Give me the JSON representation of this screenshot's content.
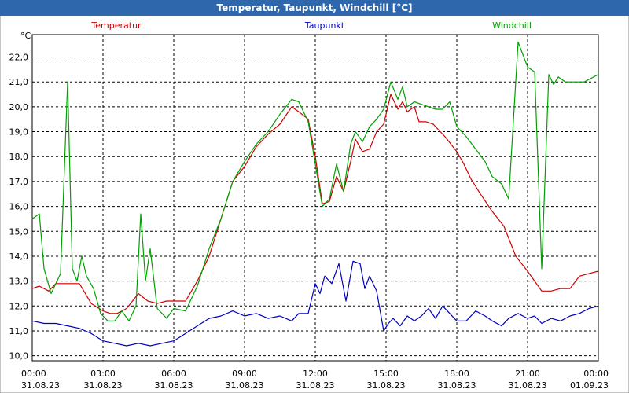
{
  "window": {
    "title": "Temperatur, Taupunkt, Windchill [°C]"
  },
  "colors": {
    "title_bar": "#2f67ad",
    "title_text": "#ffffff",
    "background": "#ffffff",
    "grid": "#000000"
  },
  "chart_data": {
    "type": "line",
    "title": "Temperatur, Taupunkt, Windchill [°C]",
    "ylabel": "°C",
    "xlabel": "",
    "ylim": [
      9.8,
      22.9
    ],
    "xlim": [
      0,
      24
    ],
    "grid": true,
    "legend_placement": "top",
    "y_ticks": [
      "10,0",
      "11,0",
      "12,0",
      "13,0",
      "14,0",
      "15,0",
      "16,0",
      "17,0",
      "18,0",
      "19,0",
      "20,0",
      "21,0",
      "22,0"
    ],
    "x_ticks": [
      {
        "time": "00:00",
        "date": "31.08.23"
      },
      {
        "time": "03:00",
        "date": "31.08.23"
      },
      {
        "time": "06:00",
        "date": "31.08.23"
      },
      {
        "time": "09:00",
        "date": "31.08.23"
      },
      {
        "time": "12:00",
        "date": "31.08.23"
      },
      {
        "time": "15:00",
        "date": "31.08.23"
      },
      {
        "time": "18:00",
        "date": "31.08.23"
      },
      {
        "time": "21:00",
        "date": "31.08.23"
      },
      {
        "time": "00:00",
        "date": "01.09.23"
      }
    ],
    "series": [
      {
        "name": "Temperatur",
        "color": "#d00000",
        "x": [
          0,
          0.3,
          0.7,
          1.0,
          1.5,
          2.0,
          2.5,
          3.0,
          3.3,
          3.6,
          4.0,
          4.5,
          4.9,
          5.3,
          5.7,
          6.0,
          6.5,
          7.0,
          7.5,
          8.0,
          8.5,
          9.0,
          9.5,
          10.0,
          10.5,
          11.0,
          11.3,
          11.7,
          12.0,
          12.3,
          12.6,
          12.9,
          13.2,
          13.5,
          13.7,
          14.0,
          14.3,
          14.6,
          14.9,
          15.2,
          15.5,
          15.7,
          15.9,
          16.2,
          16.4,
          16.7,
          17.0,
          17.5,
          18.0,
          18.3,
          18.6,
          19.0,
          19.5,
          20.0,
          20.5,
          21.0,
          21.3,
          21.6,
          22.0,
          22.4,
          22.8,
          23.2,
          23.6,
          24.0
        ],
        "values": [
          12.7,
          12.8,
          12.6,
          12.9,
          12.9,
          12.9,
          12.1,
          11.8,
          11.7,
          11.7,
          11.9,
          12.5,
          12.2,
          12.1,
          12.2,
          12.2,
          12.2,
          13.0,
          14.0,
          15.5,
          17.0,
          17.6,
          18.4,
          18.9,
          19.3,
          20.0,
          19.8,
          19.5,
          18.0,
          16.1,
          16.2,
          17.2,
          16.6,
          17.8,
          18.7,
          18.2,
          18.3,
          19.0,
          19.3,
          20.5,
          19.9,
          20.2,
          19.8,
          20.0,
          19.4,
          19.4,
          19.3,
          18.8,
          18.2,
          17.7,
          17.1,
          16.5,
          15.8,
          15.2,
          14.0,
          13.4,
          13.0,
          12.6,
          12.6,
          12.7,
          12.7,
          13.2,
          13.3,
          13.4
        ]
      },
      {
        "name": "Taupunkt",
        "color": "#0000c0",
        "x": [
          0,
          0.5,
          1.0,
          1.5,
          2.0,
          2.5,
          3.0,
          3.5,
          4.0,
          4.5,
          5.0,
          5.5,
          6.0,
          6.5,
          7.0,
          7.5,
          8.0,
          8.5,
          9.0,
          9.5,
          10.0,
          10.5,
          11.0,
          11.3,
          11.7,
          12.0,
          12.2,
          12.4,
          12.7,
          13.0,
          13.3,
          13.6,
          13.9,
          14.1,
          14.3,
          14.6,
          14.9,
          15.1,
          15.3,
          15.6,
          15.9,
          16.2,
          16.5,
          16.8,
          17.1,
          17.4,
          17.7,
          18.0,
          18.4,
          18.8,
          19.2,
          19.5,
          19.9,
          20.2,
          20.6,
          21.0,
          21.3,
          21.6,
          22.0,
          22.4,
          22.8,
          23.2,
          23.6,
          24.0
        ],
        "values": [
          11.4,
          11.3,
          11.3,
          11.2,
          11.1,
          10.9,
          10.6,
          10.5,
          10.4,
          10.5,
          10.4,
          10.5,
          10.6,
          10.9,
          11.2,
          11.5,
          11.6,
          11.8,
          11.6,
          11.7,
          11.5,
          11.6,
          11.4,
          11.7,
          11.7,
          12.9,
          12.5,
          13.2,
          12.9,
          13.7,
          12.2,
          13.8,
          13.7,
          12.7,
          13.2,
          12.6,
          11.0,
          11.3,
          11.5,
          11.2,
          11.6,
          11.4,
          11.6,
          11.9,
          11.5,
          12.0,
          11.7,
          11.4,
          11.4,
          11.8,
          11.6,
          11.4,
          11.2,
          11.5,
          11.7,
          11.5,
          11.6,
          11.3,
          11.5,
          11.4,
          11.6,
          11.7,
          11.9,
          12.0
        ]
      },
      {
        "name": "Windchill",
        "color": "#00a000",
        "x": [
          0,
          0.3,
          0.5,
          0.8,
          1.0,
          1.2,
          1.5,
          1.7,
          1.9,
          2.1,
          2.3,
          2.6,
          2.9,
          3.2,
          3.5,
          3.8,
          4.1,
          4.4,
          4.6,
          4.8,
          5.0,
          5.3,
          5.7,
          6.0,
          6.5,
          7.0,
          7.5,
          8.0,
          8.5,
          9.0,
          9.5,
          10.0,
          10.5,
          11.0,
          11.3,
          11.7,
          12.0,
          12.3,
          12.6,
          12.9,
          13.2,
          13.5,
          13.7,
          14.0,
          14.3,
          14.6,
          14.9,
          15.2,
          15.5,
          15.7,
          15.9,
          16.2,
          16.5,
          16.8,
          17.1,
          17.4,
          17.7,
          18.0,
          18.4,
          18.8,
          19.2,
          19.5,
          19.9,
          20.2,
          20.6,
          21.0,
          21.3,
          21.6,
          21.9,
          22.1,
          22.3,
          22.6,
          23.0,
          23.4,
          23.8,
          24.0
        ],
        "values": [
          15.5,
          15.7,
          13.5,
          12.5,
          12.9,
          13.3,
          21.0,
          13.5,
          13.0,
          14.0,
          13.2,
          12.7,
          11.7,
          11.4,
          11.4,
          11.8,
          11.4,
          12.0,
          15.7,
          13.0,
          14.3,
          11.9,
          11.5,
          11.9,
          11.8,
          12.8,
          14.3,
          15.5,
          17.0,
          17.8,
          18.5,
          19.0,
          19.7,
          20.3,
          20.2,
          19.4,
          17.7,
          16.0,
          16.3,
          17.7,
          16.6,
          18.5,
          19.0,
          18.6,
          19.2,
          19.5,
          19.9,
          21.0,
          20.3,
          20.8,
          20.0,
          20.2,
          20.1,
          20.0,
          19.9,
          19.9,
          20.2,
          19.2,
          18.8,
          18.3,
          17.8,
          17.2,
          16.9,
          16.3,
          22.6,
          21.6,
          21.4,
          13.5,
          21.3,
          20.9,
          21.2,
          21.0,
          21.0,
          21.0,
          21.2,
          21.3
        ]
      }
    ]
  }
}
